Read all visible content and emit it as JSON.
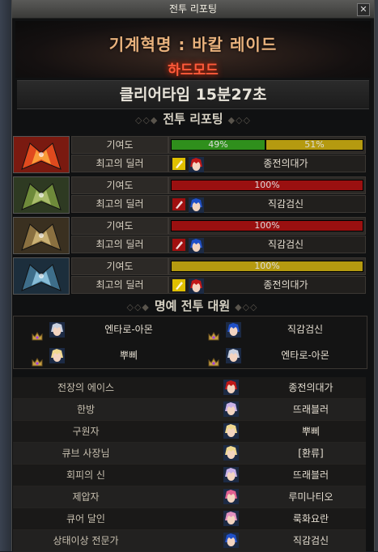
{
  "window": {
    "title": "전투 리포팅",
    "close_label": "✕"
  },
  "banner": {
    "raid_name": "기계혁명 : 바칼 레이드",
    "mode": "하드모드"
  },
  "clear_time": "클리어타임  15분27초",
  "report_heading": "전투 리포팅",
  "row_labels": {
    "contribution": "기여도",
    "top_dealer": "최고의 딜러"
  },
  "parties": [
    {
      "portrait": "red-dragon-icon",
      "bars": [
        {
          "label": "49%",
          "value": 49,
          "color": "#2f8f1c"
        },
        {
          "label": "51%",
          "value": 51,
          "color": "#b59a10"
        }
      ],
      "job_icon": "yellow-job-icon",
      "dealer": "종전의대가"
    },
    {
      "portrait": "green-dragon-icon",
      "bars": [
        {
          "label": "100%",
          "value": 100,
          "color": "#9a1010"
        }
      ],
      "job_icon": "red-job-icon",
      "dealer": "직감검신"
    },
    {
      "portrait": "gold-dragon-icon",
      "bars": [
        {
          "label": "100%",
          "value": 100,
          "color": "#9a1010"
        }
      ],
      "job_icon": "red-job-icon",
      "dealer": "직감검신"
    },
    {
      "portrait": "blue-dragon-icon",
      "bars": [
        {
          "label": "100%",
          "value": 100,
          "color": "#b59a10"
        }
      ],
      "job_icon": "yellow-job-icon",
      "dealer": "종전의대가"
    }
  ],
  "honor_heading": "명예 전투 대원",
  "honor": [
    {
      "name": "엔타로-아몬"
    },
    {
      "name": "직감검신"
    },
    {
      "name": "뿌삐"
    },
    {
      "name": "엔타로-아몬"
    }
  ],
  "titles": [
    {
      "label": "전장의 에이스",
      "name": "종전의대가"
    },
    {
      "label": "한방",
      "name": "뜨래블러"
    },
    {
      "label": "구원자",
      "name": "뿌삐"
    },
    {
      "label": "큐브 사장님",
      "name": "[환류]"
    },
    {
      "label": "회피의 신",
      "name": "뜨래블러"
    },
    {
      "label": "제압자",
      "name": "루미나티오"
    },
    {
      "label": "큐어 달인",
      "name": "룩화요란"
    },
    {
      "label": "상태이상 전문가",
      "name": "직감검신"
    }
  ],
  "colors": {
    "accent": "#e9b27d",
    "hardmode": "#ff5a3a"
  }
}
